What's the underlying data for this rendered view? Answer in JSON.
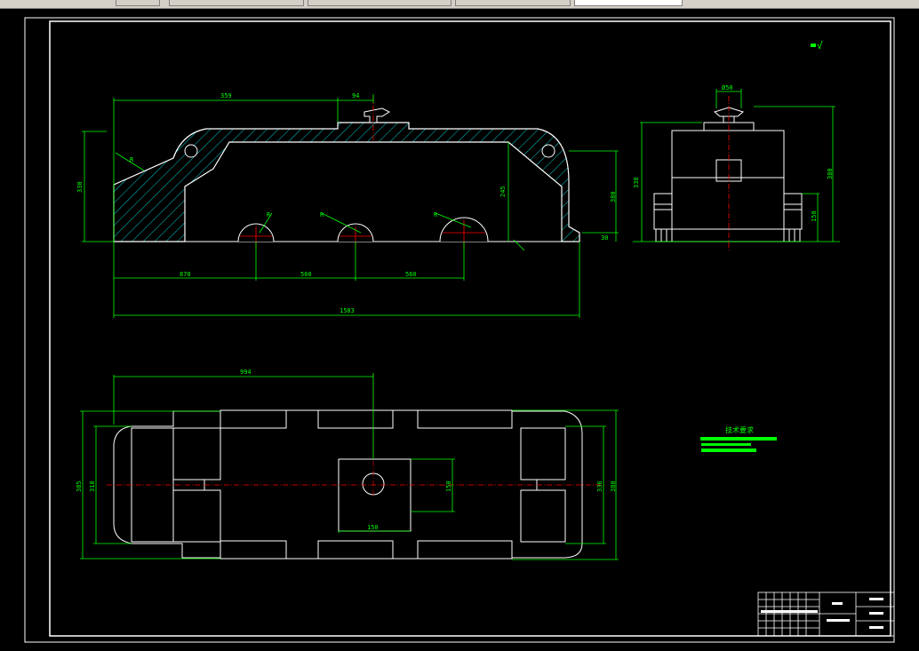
{
  "window": {
    "tabs": [
      {
        "label": "",
        "active": false
      },
      {
        "label": "",
        "active": false
      },
      {
        "label": "",
        "active": false
      },
      {
        "label": "",
        "active": false
      },
      {
        "label": "",
        "active": true
      }
    ]
  },
  "drawing": {
    "roughness_symbol": "√",
    "front_view_dims": {
      "top_length": "359",
      "top_offset": "94",
      "total_length": "1583",
      "left_height": "330",
      "inner_height": "245",
      "right_height": "380",
      "small_right": "30",
      "bottom_left": "870",
      "bottom_mid": "560",
      "bottom_right": "560",
      "radius_1": "R",
      "radius_2": "R",
      "radius_3": "R"
    },
    "side_view_dims": {
      "top_width": "Ø50",
      "left_height": "338",
      "right_height": "380",
      "right_small": "150"
    },
    "plan_view_dims": {
      "top_length": "994",
      "left_outer": "385",
      "left_inner": "318",
      "right_outer": "380",
      "right_inner": "336",
      "center_width": "150",
      "center_height": "150"
    },
    "tech_requirements_title": "技术要求",
    "colors": {
      "outline": "#ffffff",
      "dimension": "#00ff00",
      "centerline": "#ff0000",
      "hatch": "#00ffff",
      "border": "#ffffff",
      "tabbar": "#d4d0c8"
    }
  }
}
